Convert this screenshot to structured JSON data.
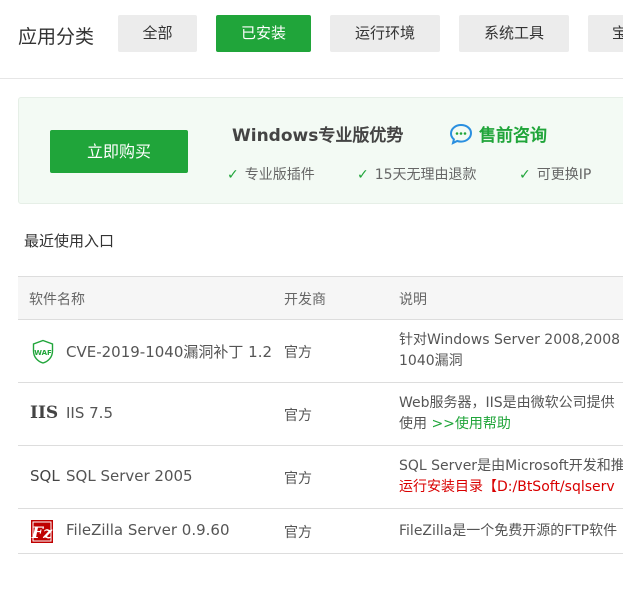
{
  "header": {
    "title": "应用分类",
    "tabs": [
      {
        "label": "全部"
      },
      {
        "label": "已安装"
      },
      {
        "label": "运行环境"
      },
      {
        "label": "系统工具"
      },
      {
        "label": "宝"
      }
    ],
    "active_tab": "已安装"
  },
  "promo": {
    "buy_label": "立即购买",
    "title": "Windows专业版优势",
    "consult_label": "售前咨询",
    "features": [
      {
        "label": "专业版插件"
      },
      {
        "label": "15天无理由退款"
      },
      {
        "label": "可更换IP"
      }
    ]
  },
  "recent_label": "最近使用入口",
  "table": {
    "headers": {
      "name": "软件名称",
      "developer": "开发商",
      "description": "说明"
    },
    "rows": [
      {
        "icon": "waf-icon",
        "name": "CVE-2019-1040漏洞补丁 1.2",
        "developer": "官方",
        "desc_line1": "针对Windows Server 2008,2008",
        "desc_line2": "1040漏洞"
      },
      {
        "icon": "iis-icon",
        "icon_text": "IIS",
        "name": "IIS 7.5",
        "developer": "官方",
        "desc_line1": "Web服务器，IIS是由微软公司提供",
        "desc_line2_prefix": "使用",
        "desc_line2_link": " >>使用帮助"
      },
      {
        "icon": "sql-icon",
        "icon_text": "SQL",
        "name": "SQL Server 2005",
        "developer": "官方",
        "desc_line1": "SQL Server是由Microsoft开发和推",
        "desc_line2": "运行安装目录【D:/BtSoft/sqlserv"
      },
      {
        "icon": "filezilla-icon",
        "name": "FileZilla Server 0.9.60",
        "developer": "官方",
        "desc_line1": "FileZilla是一个免费开源的FTP软件"
      }
    ]
  },
  "colors": {
    "accent": "#20a53a",
    "warning_text": "#d90000"
  }
}
